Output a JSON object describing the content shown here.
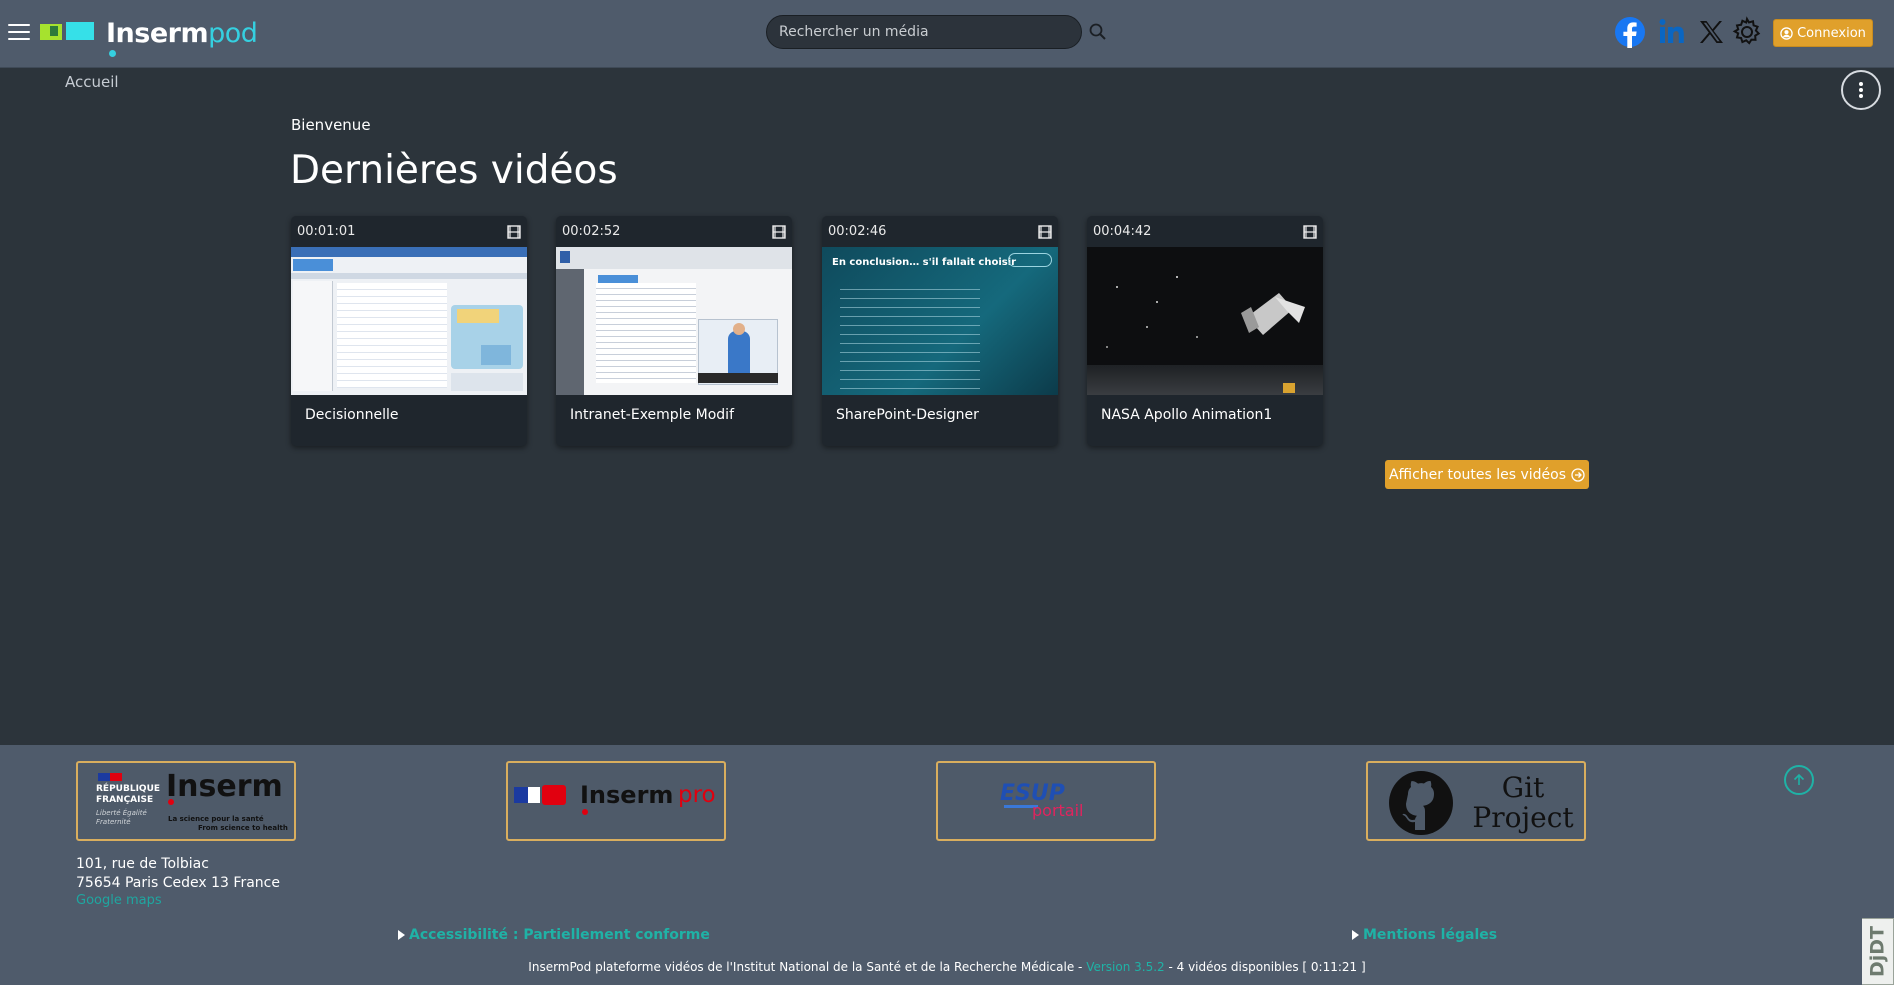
{
  "header": {
    "logo_inserm": "Inserm",
    "logo_pod": "pod",
    "search_placeholder": "Rechercher un média",
    "social": [
      "facebook",
      "linkedin",
      "x",
      "settings"
    ],
    "login_label": "Connexion"
  },
  "breadcrumb": {
    "home": "Accueil"
  },
  "main": {
    "welcome": "Bienvenue",
    "title": "Dernières vidéos",
    "videos": [
      {
        "duration": "00:01:01",
        "title": "Decisionnelle"
      },
      {
        "duration": "00:02:52",
        "title": "Intranet-Exemple Modif"
      },
      {
        "duration": "00:02:46",
        "title": "SharePoint-Designer"
      },
      {
        "duration": "00:04:42",
        "title": "NASA Apollo Animation1"
      }
    ],
    "all_videos_label": "Afficher toutes les vidéos",
    "thumb3_heading": "En conclusion… s'il fallait choisir"
  },
  "footer": {
    "partners": {
      "inserm": {
        "rf": "RÉPUBLIQUE FRANÇAISE",
        "name": "Inserm",
        "tag1": "La science pour la santé",
        "tag2": "From science to health",
        "motto": "Liberté Égalité Fraternité"
      },
      "insermpro": {
        "name": "Inserm",
        "pro": "pro"
      },
      "esup": {
        "top": "ESUP",
        "bottom": "portail"
      },
      "git": {
        "line1": "Git",
        "line2": "Project"
      }
    },
    "address_line1": "101, rue de Tolbiac",
    "address_line2": "75654 Paris Cedex 13 France",
    "maps_link": "Google maps",
    "accessibility": "Accessibilité : Partiellement conforme",
    "legal": "Mentions légales",
    "copyright_prefix": "InsermPod plateforme vidéos de l'Institut National de la Santé et de la Recherche Médicale - ",
    "version": "Version 3.5.2",
    "copyright_suffix": " - 4 vidéos disponibles [ 0:11:21 ]"
  },
  "debug": {
    "djdt": "DjDT"
  },
  "colors": {
    "accent": "#e0a02b",
    "teal": "#1fb2a6",
    "header_bg": "#4f5b6b",
    "page_bg": "#2c343b"
  }
}
